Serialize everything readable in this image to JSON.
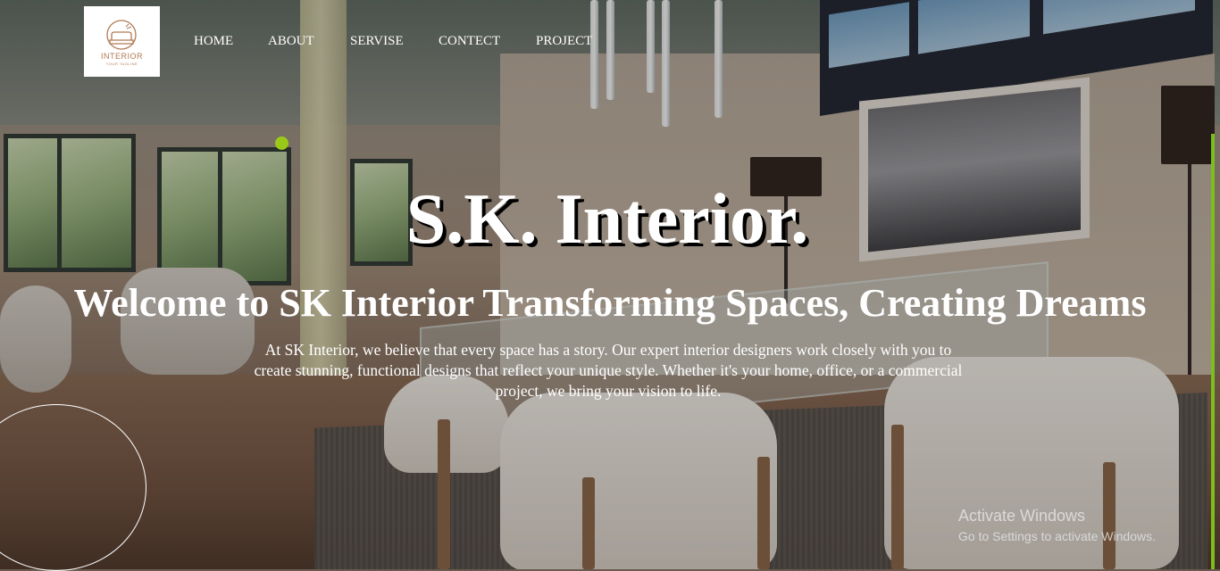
{
  "logo": {
    "brand": "INTERIOR",
    "tagline": "YOUR TAGLINE",
    "icon": "sofa-logo-icon"
  },
  "nav": {
    "items": [
      "HOME",
      "ABOUT",
      "SERVISE",
      "CONTECT",
      "PROJECT"
    ]
  },
  "hero": {
    "title": "S.K. Interior.",
    "subtitle": "Welcome to SK Interior Transforming Spaces, Creating Dreams",
    "description": "At SK Interior, we believe that every space has a story. Our expert interior designers work closely with you to create stunning, functional designs that reflect your unique style. Whether it's your home, office, or a commercial project, we bring your vision to life."
  },
  "watermark": {
    "title": "Activate Windows",
    "subtitle": "Go to Settings to activate Windows."
  },
  "colors": {
    "accent_dot": "#9ac918",
    "logo_text": "#b07a54",
    "text": "#ffffff"
  }
}
